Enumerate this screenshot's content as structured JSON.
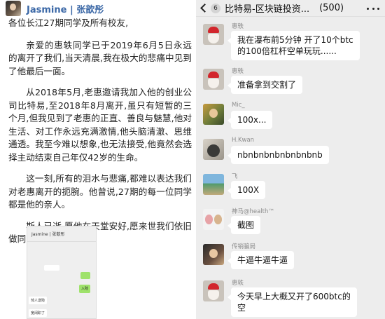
{
  "post": {
    "author": "Jasmine | 张歆彤",
    "paragraphs": [
      "各位长江27期同学及所有校友,",
      "亲爱的惠轶同学已于2019年6月5日永远的离开了我们,当天清晨,我在极大的悲痛中见到了他最后一面。",
      "从2018年5月,老惠邀请我加入他的创业公司比特易,至2018年8月离开,虽只有短暂的三个月,但我见到了老惠的正直、善良与魅慧,他对生活、对工作永远充满激情,他头脑清澈、思维通透。我至今难以想象,也无法接受,他竟然会选择主动结束自己年仅42岁的生命。",
      "这一刻,所有的泪水与悲痛,都难以表达我们对老惠离开的扼腕。他曾说,27期的每一位同学都是他的亲人。",
      "斯人已逝,愿他在天堂安好,愿来世我们依旧做同学。"
    ],
    "thumb": {
      "title": "Jasmine | 张歆彤",
      "bubble_text": "入殓",
      "label_1": "悼人送殓",
      "label_2": "宽阔职了"
    }
  },
  "chat": {
    "unread": "6",
    "title": "比特易-区块链投资...",
    "member_count": "(500)",
    "messages": [
      {
        "name": "惠轶",
        "text_lines": [
          "我在瀑布前5分钟 开了10个btc",
          "的100倍杠杆空单玩玩......"
        ]
      },
      {
        "name": "惠轶",
        "text_lines": [
          "准备拿到交割了"
        ]
      },
      {
        "name": "Mic_",
        "text_lines": [
          "100x..."
        ]
      },
      {
        "name": "H.Kwan",
        "text_lines": [
          "nbnbnbnbnbnbnbnb"
        ]
      },
      {
        "name": "飞",
        "text_lines": [
          "100X"
        ]
      },
      {
        "name": "神马@health™",
        "text_lines": [
          "截图"
        ]
      },
      {
        "name": "传销骗局",
        "text_lines": [
          "牛逼牛逼牛逼"
        ]
      },
      {
        "name": "惠轶",
        "text_lines": [
          "今天早上大概又开了600btc的",
          "空"
        ]
      }
    ]
  }
}
